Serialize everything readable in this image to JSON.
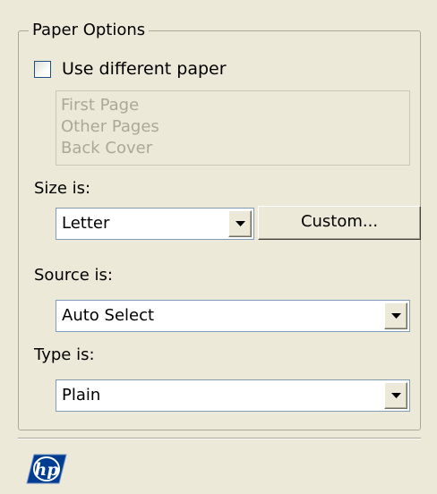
{
  "paper_options": {
    "title": "Paper Options",
    "use_different_paper": {
      "label": "Use different paper",
      "checked": false
    },
    "page_list": [
      "First Page",
      "Other Pages",
      "Back Cover"
    ],
    "size": {
      "label": "Size is:",
      "value": "Letter",
      "custom_button": "Custom..."
    },
    "source": {
      "label": "Source is:",
      "value": "Auto Select"
    },
    "type": {
      "label": "Type is:",
      "value": "Plain"
    }
  },
  "logo": {
    "text": "hp",
    "color": "#003c8f"
  },
  "colors": {
    "background": "#ece9d8",
    "group_border": "#aca899",
    "disabled_text": "#aca899",
    "field_border": "#7f9db9"
  }
}
